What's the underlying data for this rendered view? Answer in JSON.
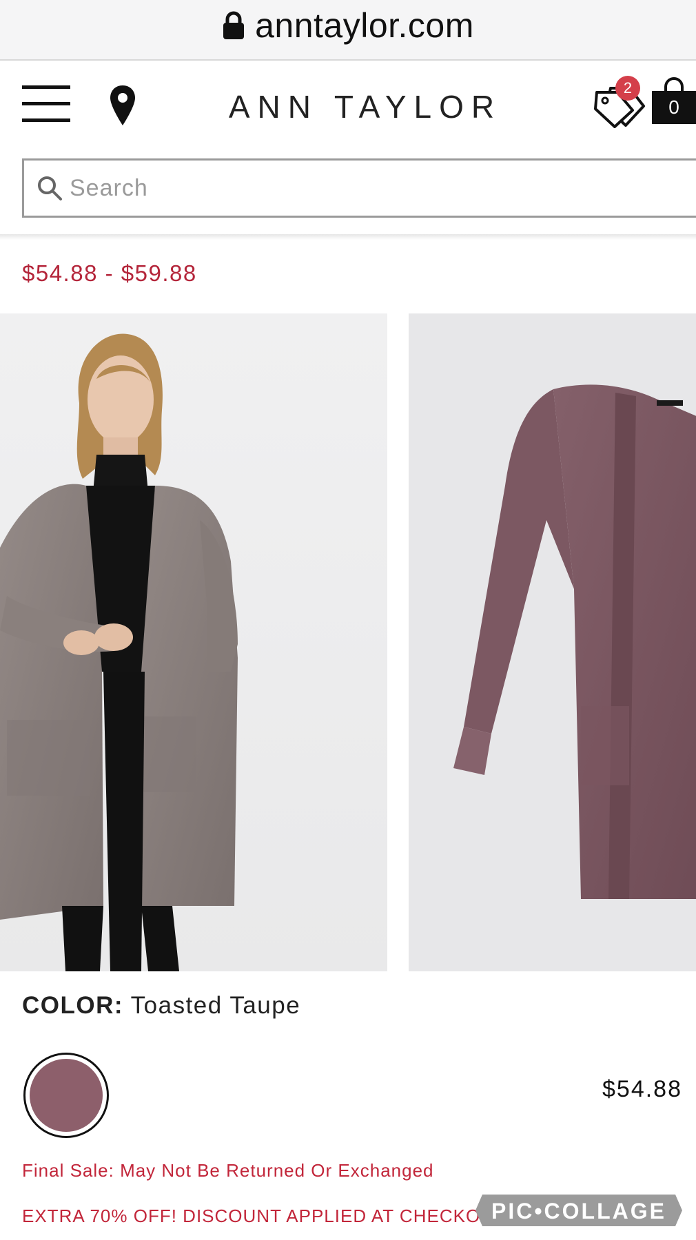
{
  "browser": {
    "url": "anntaylor.com"
  },
  "header": {
    "brand": "ANN TAYLOR",
    "offers_badge": "2",
    "bag_count": "0"
  },
  "search": {
    "placeholder": "Search",
    "value": ""
  },
  "product": {
    "price_range": "$54.88 - $59.88",
    "color_label": "COLOR:",
    "color_name": "Toasted Taupe",
    "swatch_color": "#8d5f6b",
    "price": "$54.88",
    "final_sale": "Final Sale: May Not Be Returned Or Exchanged",
    "promo": "EXTRA 70% OFF! DISCOUNT APPLIED AT CHECKOUT"
  },
  "watermark": {
    "text": "PIC•COLLAGE"
  },
  "colors": {
    "accent_red": "#c2263a",
    "badge_red": "#d43f4a",
    "cardigan_taupe": "#857a78",
    "cardigan_mauve": "#7a5560"
  },
  "icons": [
    "lock-icon",
    "menu-icon",
    "location-pin-icon",
    "offers-tag-icon",
    "shopping-bag-icon",
    "search-icon"
  ]
}
